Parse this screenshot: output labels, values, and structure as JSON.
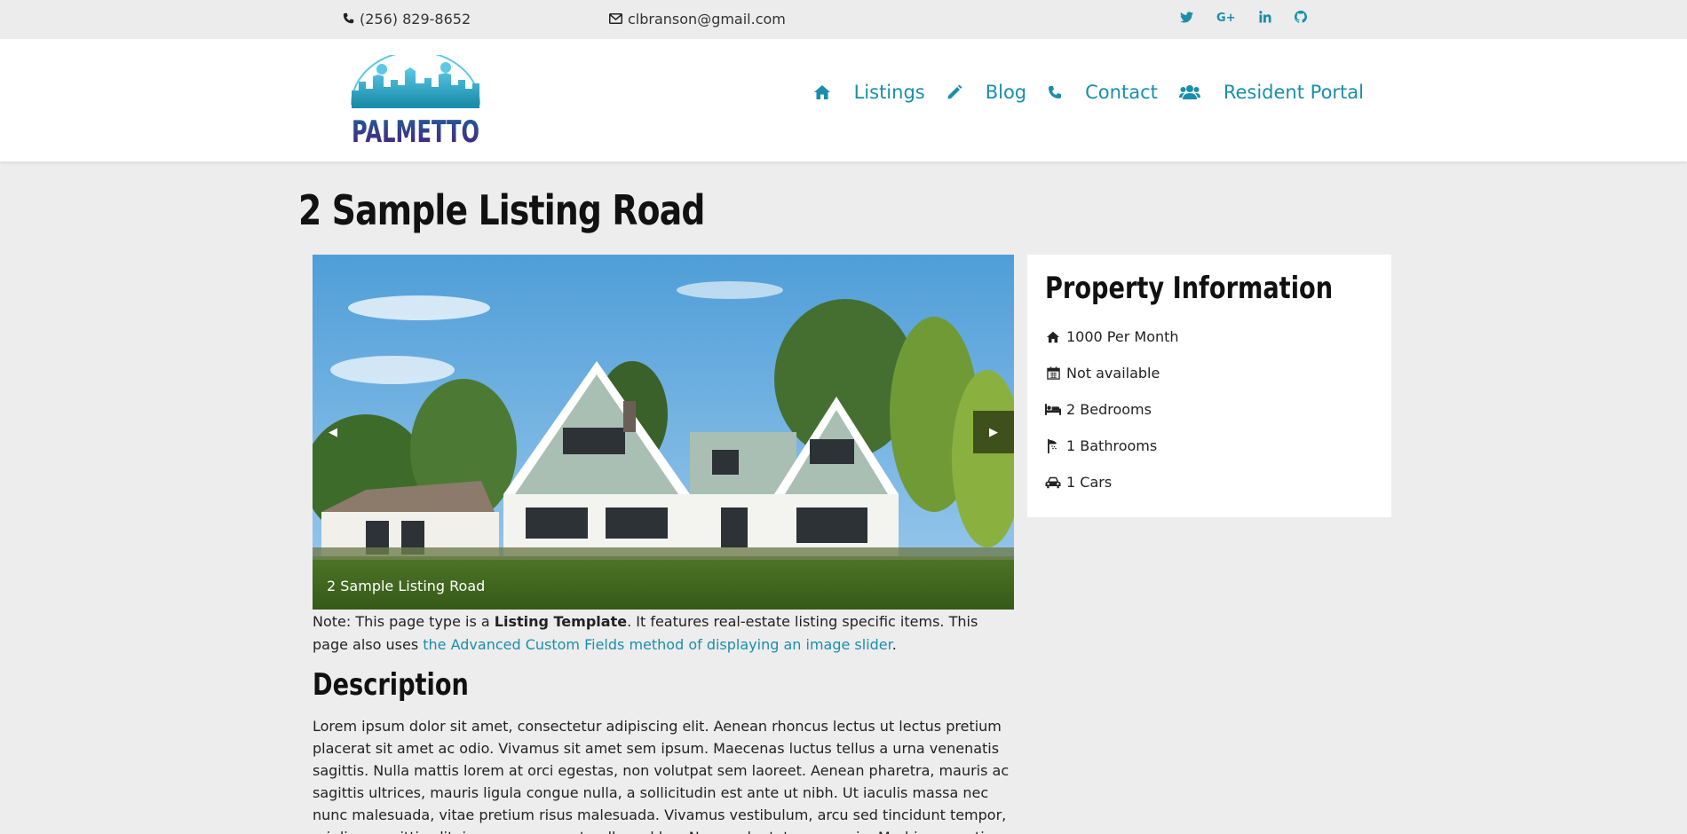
{
  "topbar": {
    "phone": "(256) 829-8652",
    "email": "clbranson@gmail.com",
    "social": [
      "twitter-icon",
      "google-plus-icon",
      "linkedin-icon",
      "github-icon"
    ]
  },
  "header": {
    "logo_text": "PALMETTO",
    "nav": [
      {
        "icon": "home-icon",
        "label": "Listings"
      },
      {
        "icon": "pencil-icon",
        "label": "Blog"
      },
      {
        "icon": "phone-icon",
        "label": "Contact"
      },
      {
        "icon": "users-icon",
        "label": "Resident Portal"
      }
    ]
  },
  "page": {
    "title": "2 Sample Listing Road"
  },
  "slider": {
    "caption": "2 Sample Listing Road",
    "prev_glyph": "◀",
    "next_glyph": "▶"
  },
  "note": {
    "prefix": "Note: This page type is a ",
    "bold": "Listing Template",
    "middle": ". It features real-estate listing specific items. This page also uses ",
    "link": "the Advanced Custom Fields method of displaying an image slider",
    "suffix": "."
  },
  "description": {
    "heading": "Description",
    "body": "Lorem ipsum dolor sit amet, consectetur adipiscing elit. Aenean rhoncus lectus ut lectus pretium placerat sit amet ac odio. Vivamus sit amet sem ipsum. Maecenas luctus tellus a urna venenatis sagittis. Nulla mattis lorem at orci egestas, non volutpat sem laoreet. Aenean pharetra, mauris ac sagittis ultrices, mauris ligula congue nulla, a sollicitudin est ante ut nibh. Ut iaculis massa nec nunc malesuada, vitae pretium risus malesuada. Vivamus vestibulum, arcu sed tincidunt tempor, mi diam sagittis elit, in accumsan erat nulla sed leo. Nunc vulputate magna in. Morbi venenatis consequat nulla tempor ornare, accumsan non gravida."
  },
  "property": {
    "title": "Property Information",
    "items": [
      {
        "icon": "home-icon",
        "text": "1000 Per Month"
      },
      {
        "icon": "calendar-icon",
        "text": "Not available"
      },
      {
        "icon": "bed-icon",
        "text": "2 Bedrooms"
      },
      {
        "icon": "shower-icon",
        "text": "1 Bathrooms"
      },
      {
        "icon": "car-icon",
        "text": "1 Cars"
      }
    ]
  },
  "colors": {
    "accent": "#1a8eab",
    "page_bg": "#ededed",
    "logo_purple": "#3a2a7a"
  }
}
